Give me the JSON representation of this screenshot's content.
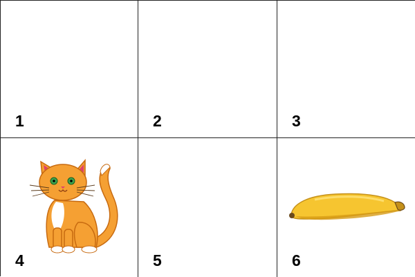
{
  "cards": [
    {
      "number": "1",
      "content": "empty"
    },
    {
      "number": "2",
      "content": "empty"
    },
    {
      "number": "3",
      "content": "empty"
    },
    {
      "number": "4",
      "content": "cat"
    },
    {
      "number": "5",
      "content": "empty"
    },
    {
      "number": "6",
      "content": "banana"
    }
  ],
  "colors": {
    "grid_line": "#222222",
    "cat_body": "#F5A033",
    "cat_outline": "#C76A10",
    "cat_white": "#FFFFFF",
    "cat_eyes": "#3FA34D",
    "banana_yellow": "#F6C530",
    "banana_shadow": "#D79B15",
    "banana_tip": "#6B4A1C"
  }
}
